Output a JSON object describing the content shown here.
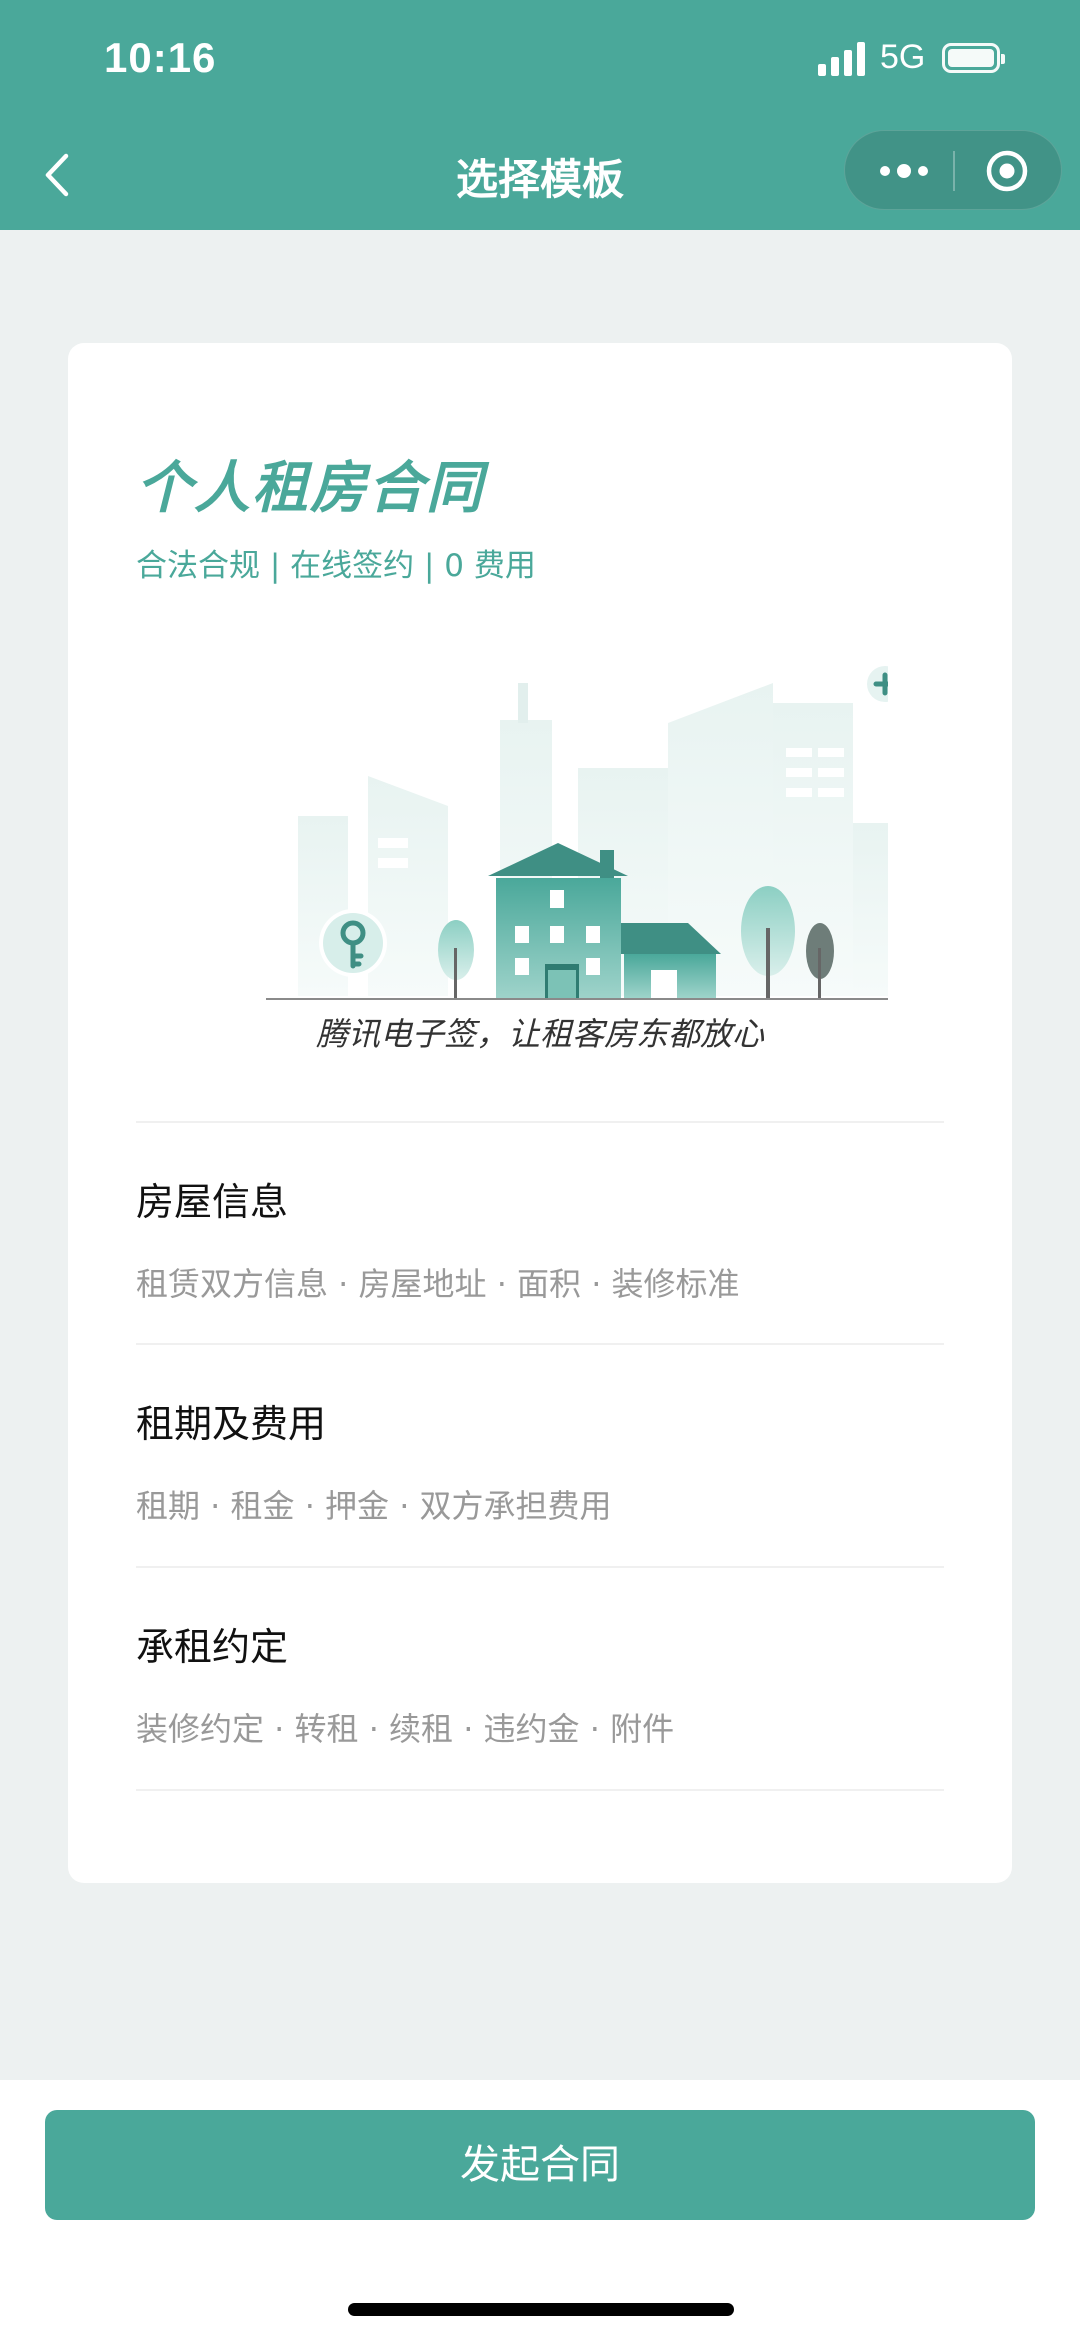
{
  "status_bar": {
    "time": "10:16",
    "network": "5G",
    "icons": [
      "signal-icon",
      "battery-icon"
    ]
  },
  "nav": {
    "title": "选择模板",
    "icons": [
      "back-icon",
      "more-icon",
      "target-icon"
    ]
  },
  "template": {
    "title": "个人租房合同",
    "subtitle": "合法合规 | 在线签约 | 0 费用",
    "slogan": "腾讯电子签，让租客房东都放心",
    "sections": [
      {
        "title": "房屋信息",
        "desc": "租赁双方信息 · 房屋地址 · 面积 · 装修标准"
      },
      {
        "title": "租期及费用",
        "desc": "租期 · 租金 · 押金 · 双方承担费用"
      },
      {
        "title": "承租约定",
        "desc": "装修约定 · 转租 · 续租 · 违约金 · 附件"
      }
    ]
  },
  "action": {
    "start_contract_label": "发起合同"
  },
  "colors": {
    "brand": "#4aa89a",
    "page_background": "#edf1f1",
    "card_background": "#ffffff",
    "muted_text": "#999999"
  }
}
